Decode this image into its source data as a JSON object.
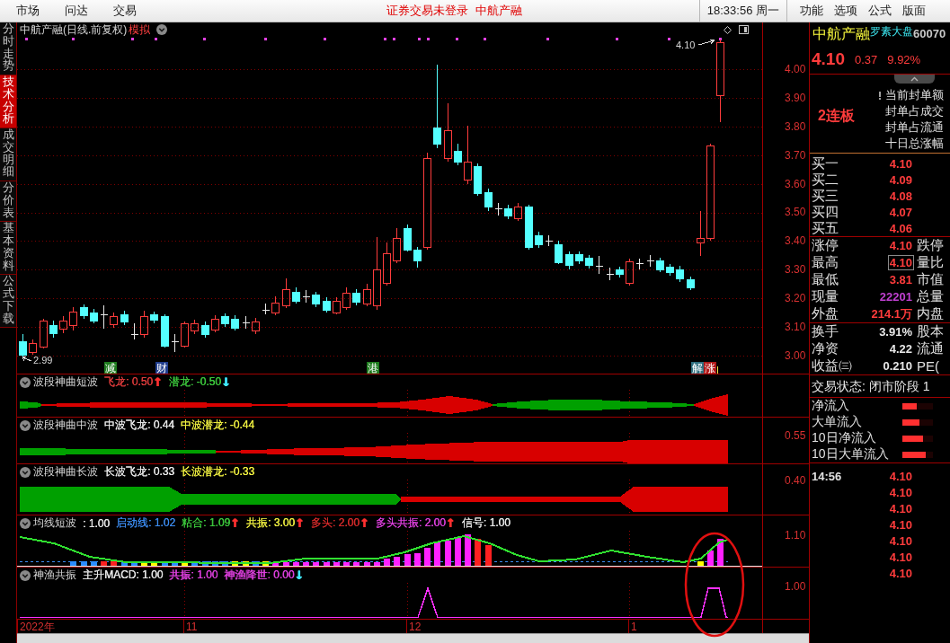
{
  "menu_bar": {
    "items": [
      "市场",
      "问达",
      "交易"
    ],
    "login_status": "证券交易未登录",
    "stock_name": "中航产融",
    "clock": "18:33:56 周一",
    "tools": [
      "功能",
      "选项",
      "公式",
      "版面"
    ]
  },
  "side_tabs": [
    {
      "label": "分时走势",
      "selected": false
    },
    {
      "label": "技术分析",
      "selected": true
    },
    {
      "label": "成交明细",
      "selected": false
    },
    {
      "label": "分价表",
      "selected": false
    },
    {
      "label": "基本资料",
      "selected": false
    },
    {
      "label": "公式下载",
      "selected": false
    }
  ],
  "main_chart": {
    "title": "中航产融(日线.前复权)",
    "mode": "模拟",
    "high_label": "4.10",
    "low_label": "2.99",
    "price_axis": [
      "4.00",
      "3.90",
      "3.80",
      "3.70",
      "3.60",
      "3.50",
      "3.40",
      "3.30",
      "3.20",
      "3.10",
      "3.00"
    ],
    "event_tags": [
      {
        "label": "减",
        "color": "#1e7b1e"
      },
      {
        "label": "财",
        "color": "#1f3c8c"
      },
      {
        "label": "港",
        "color": "#1e7b1e"
      },
      {
        "label": "解",
        "color": "#2f6f7f"
      },
      {
        "label": "涨",
        "color": "#b01818"
      }
    ]
  },
  "indicators": [
    {
      "kind": "wave",
      "name": "波段神曲短波",
      "items": [
        {
          "kind": "value",
          "text": "飞龙: 0.50",
          "color": "#e03c3c"
        },
        {
          "kind": "arrow",
          "text": "↑",
          "color": "#ff3030"
        },
        {
          "kind": "value",
          "text": "潜龙: -0.50",
          "color": "#3cc83c"
        },
        {
          "kind": "arrow",
          "text": "↓",
          "color": "#40e8ff"
        }
      ]
    },
    {
      "kind": "wave",
      "name": "波段神曲中波",
      "items": [
        {
          "kind": "value",
          "text": "中波飞龙: 0.44",
          "color": "#e8e8e8"
        },
        {
          "kind": "value",
          "text": "中波潜龙: -0.44",
          "color": "#f0f040"
        }
      ],
      "axis_label": "0.55"
    },
    {
      "kind": "wave",
      "name": "波段神曲长波",
      "items": [
        {
          "kind": "value",
          "text": "长波飞龙: 0.33",
          "color": "#e8e8e8"
        },
        {
          "kind": "value",
          "text": "长波潜龙: -0.33",
          "color": "#f0f040"
        }
      ],
      "axis_label": "0.40"
    },
    {
      "kind": "histogram",
      "name": "均线短波",
      "items": [
        {
          "kind": "value",
          "text": ": 1.00",
          "color": "#e8e8e8"
        },
        {
          "kind": "value",
          "text": "启动线: 1.02",
          "color": "#3c8cf0"
        },
        {
          "kind": "value",
          "text": "粘合: 1.09",
          "color": "#3cc83c"
        },
        {
          "kind": "arrow",
          "text": "↑",
          "color": "#ff3030"
        },
        {
          "kind": "value",
          "text": "共振: 3.00",
          "color": "#f0f040"
        },
        {
          "kind": "arrow",
          "text": "↑",
          "color": "#ff3030"
        },
        {
          "kind": "value",
          "text": "多头: 2.00",
          "color": "#d42a2a"
        },
        {
          "kind": "arrow",
          "text": "↑",
          "color": "#ff3030"
        },
        {
          "kind": "value",
          "text": "多头共振: 2.00",
          "color": "#e040e0"
        },
        {
          "kind": "arrow",
          "text": "↑",
          "color": "#ff3030"
        },
        {
          "kind": "value",
          "text": "信号: 1.00",
          "color": "#e8e8e8"
        }
      ],
      "axis_label": "1.10"
    },
    {
      "kind": "pulse",
      "name": "神渔共振",
      "items": [
        {
          "kind": "value",
          "text": "主升MACD: 1.00",
          "color": "#e8e8e8"
        },
        {
          "kind": "value",
          "text": "共振: 1.00",
          "color": "#e040e0"
        },
        {
          "kind": "value",
          "text": "神渔降世: 0.00",
          "color": "#e040e0"
        },
        {
          "kind": "arrow",
          "text": "↓",
          "color": "#40e8ff"
        }
      ],
      "axis_label": "1.00"
    }
  ],
  "date_axis": [
    "2022年",
    "11",
    "12",
    "1"
  ],
  "quote": {
    "name": "中航产融",
    "index_tag": "罗素大盘",
    "code": "60070",
    "price": "4.10",
    "change": "0.37",
    "change_pct": "9.92%",
    "streak": "2连板",
    "seal_info": [
      "当前封单额",
      "封单占成交",
      "封单占流通",
      "十日总涨幅"
    ],
    "bids": [
      {
        "label": "买一",
        "price": "4.10"
      },
      {
        "label": "买二",
        "price": "4.09"
      },
      {
        "label": "买三",
        "price": "4.08"
      },
      {
        "label": "买四",
        "price": "4.07"
      },
      {
        "label": "买五",
        "price": "4.06"
      }
    ],
    "stats": [
      {
        "label": "涨停",
        "value": "4.10",
        "color": "#ff3c3c",
        "highlighted": false,
        "extra": "跌停"
      },
      {
        "label": "最高",
        "value": "4.10",
        "color": "#ff3c3c",
        "highlighted": true,
        "extra": "量比"
      },
      {
        "label": "最低",
        "value": "3.81",
        "color": "#ff3c3c",
        "highlighted": false,
        "extra": "市值"
      },
      {
        "label": "现量",
        "value": "22201",
        "color": "#c040d0",
        "highlighted": false,
        "extra": "总量"
      },
      {
        "label": "外盘",
        "value": "214.1万",
        "color": "#ff3c3c",
        "highlighted": false,
        "extra": "内盘"
      }
    ],
    "fundamentals": [
      {
        "label": "换手",
        "value": "3.91%",
        "extra": "股本"
      },
      {
        "label": "净资",
        "value": "4.22",
        "extra": "流通"
      },
      {
        "label": "收益㈢",
        "value": "0.210",
        "extra": "PE("
      }
    ],
    "trade_status": "交易状态: 闭市阶段 1",
    "flows": [
      {
        "label": "净流入",
        "level": 0.47
      },
      {
        "label": "大单流入",
        "level": 0.56
      },
      {
        "label": "10日净流入",
        "level": 0.69
      },
      {
        "label": "10日大单流入",
        "level": 0.75
      }
    ],
    "ticks": [
      {
        "time": "14:56",
        "price": "4.10"
      },
      {
        "price": "4.10"
      },
      {
        "price": "4.10"
      },
      {
        "price": "4.10"
      },
      {
        "price": "4.10"
      },
      {
        "price": "4.10"
      },
      {
        "price": "4.10"
      }
    ]
  }
}
